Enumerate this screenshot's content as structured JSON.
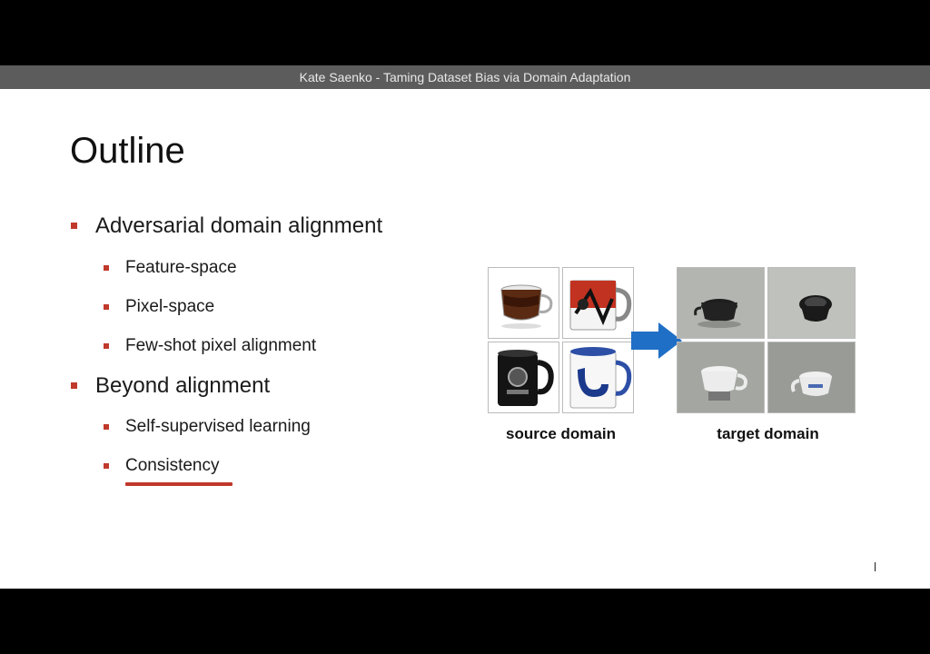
{
  "video": {
    "title": "Kate Saenko - Taming Dataset Bias via Domain Adaptation"
  },
  "slide": {
    "heading": "Outline",
    "bullets": [
      {
        "label": "Adversarial domain alignment",
        "subitems": [
          "Feature-space",
          "Pixel-space",
          "Few-shot pixel alignment"
        ]
      },
      {
        "label": "Beyond alignment",
        "subitems": [
          "Self-supervised learning",
          "Consistency"
        ]
      }
    ],
    "highlighted_item": "Consistency",
    "figure": {
      "source_caption": "source domain",
      "target_caption": "target domain"
    },
    "page_mark": "l"
  },
  "colors": {
    "bullet": "#c0392b",
    "arrow": "#1f6fc6",
    "titlebar": "#5c5c5c"
  }
}
